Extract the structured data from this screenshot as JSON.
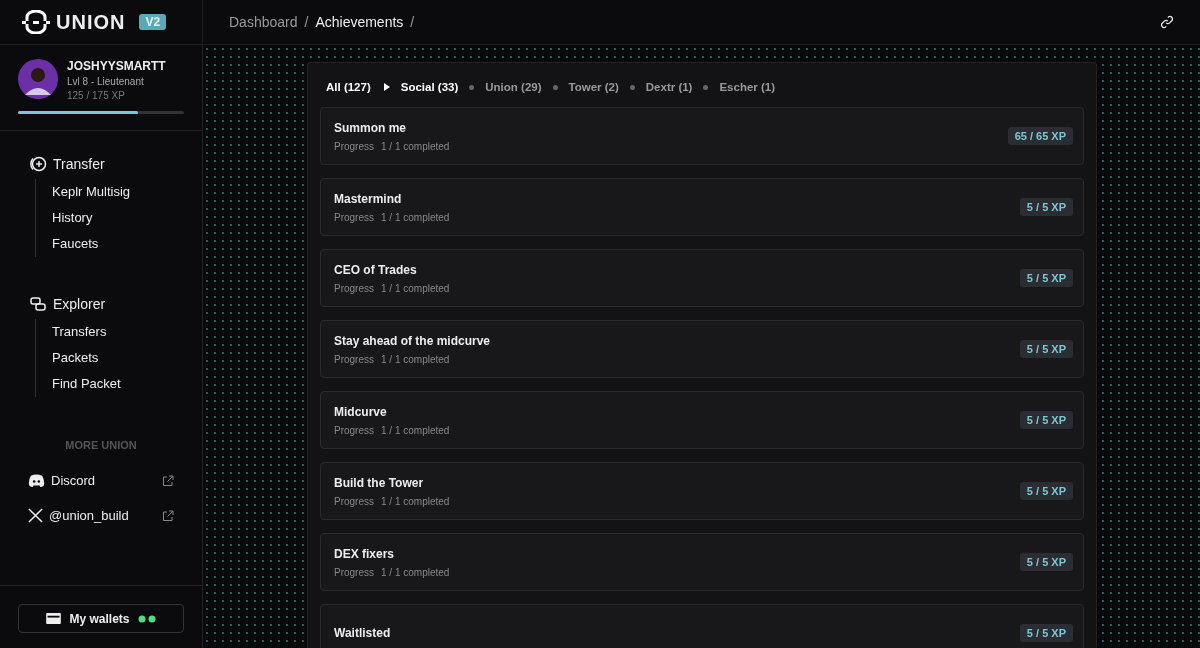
{
  "brand": {
    "name": "UNION",
    "badge": "V2"
  },
  "breadcrumb": [
    {
      "label": "Dashboard",
      "kind": "link"
    },
    {
      "label": "/",
      "kind": "sep"
    },
    {
      "label": "Achievements",
      "kind": "current"
    },
    {
      "label": "/",
      "kind": "sep"
    }
  ],
  "user": {
    "name": "JOSHYYSMARTT",
    "rank": "Lvl 8 - Lieutenant",
    "xp": "125 / 175 XP",
    "level": 0.72
  },
  "nav": [
    {
      "label": "Transfer",
      "kind": "transfer",
      "children": [
        {
          "label": "Keplr Multisig"
        },
        {
          "label": "History"
        },
        {
          "label": "Faucets"
        }
      ]
    },
    {
      "label": "Explorer",
      "kind": "explorer",
      "children": [
        {
          "label": "Transfers"
        },
        {
          "label": "Packets"
        },
        {
          "label": "Find Packet"
        }
      ]
    }
  ],
  "more": {
    "heading": "MORE UNION",
    "links": [
      {
        "label": "Discord",
        "kind": "discord"
      },
      {
        "label": "@union_build",
        "kind": "x"
      }
    ]
  },
  "wallets": {
    "label": "My wallets"
  },
  "tabs": [
    {
      "label": "All (127)",
      "kind": "root",
      "selected": true
    },
    {
      "label": "Social (33)",
      "kind": "leaf",
      "selected": true
    },
    {
      "label": "Union (29)",
      "kind": "leaf",
      "selected": false
    },
    {
      "label": "Tower (2)",
      "kind": "leaf",
      "selected": false
    },
    {
      "label": "Dextr (1)",
      "kind": "leaf",
      "selected": false
    },
    {
      "label": "Escher (1)",
      "kind": "leaf",
      "selected": false
    }
  ],
  "achievements": [
    {
      "title": "Summon me",
      "progress_label": "Progress",
      "progress": "1 / 1 completed",
      "xp": "65 / 65 XP"
    },
    {
      "title": "Mastermind",
      "progress_label": "Progress",
      "progress": "1 / 1 completed",
      "xp": "5 / 5 XP"
    },
    {
      "title": "CEO of Trades",
      "progress_label": "Progress",
      "progress": "1 / 1 completed",
      "xp": "5 / 5 XP"
    },
    {
      "title": "Stay ahead of the midcurve",
      "progress_label": "Progress",
      "progress": "1 / 1 completed",
      "xp": "5 / 5 XP"
    },
    {
      "title": "Midcurve",
      "progress_label": "Progress",
      "progress": "1 / 1 completed",
      "xp": "5 / 5 XP"
    },
    {
      "title": "Build the Tower",
      "progress_label": "Progress",
      "progress": "1 / 1 completed",
      "xp": "5 / 5 XP"
    },
    {
      "title": "DEX fixers",
      "progress_label": "Progress",
      "progress": "1 / 1 completed",
      "xp": "5 / 5 XP"
    },
    {
      "title": "Waitlisted",
      "xp": "5 / 5 XP"
    }
  ]
}
